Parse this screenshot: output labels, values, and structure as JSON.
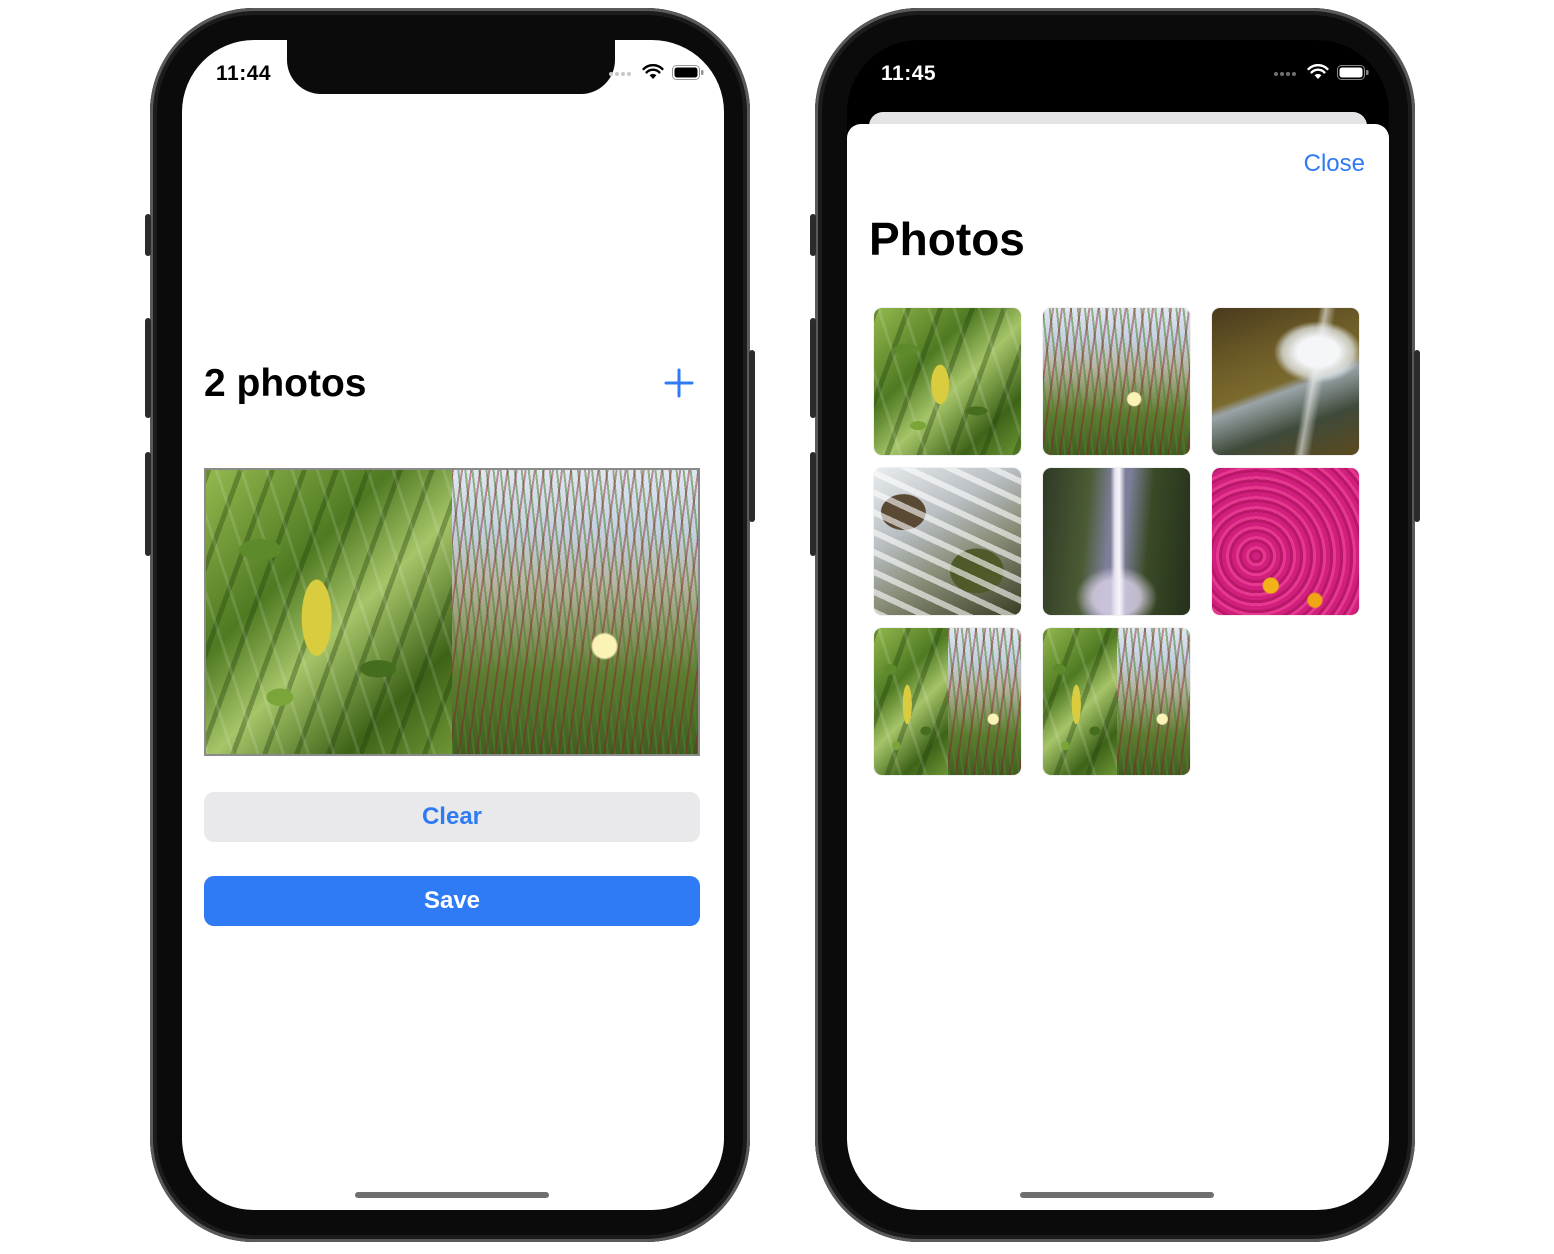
{
  "left_phone": {
    "status": {
      "time": "11:44"
    },
    "header": {
      "title": "2 photos",
      "add_icon": "plus-icon"
    },
    "collage": {
      "photos": [
        "leaf-photo",
        "dune-flower-photo"
      ]
    },
    "buttons": {
      "clear_label": "Clear",
      "save_label": "Save"
    }
  },
  "right_phone": {
    "status": {
      "time": "11:45"
    },
    "sheet": {
      "close_label": "Close",
      "title": "Photos",
      "thumbnails": [
        "leaf-photo",
        "dune-flower-photo",
        "cliff-waterfall-photo",
        "stream-rocks-photo",
        "tall-waterfall-photo",
        "pink-flowers-photo",
        "leaf-dune-collage",
        "leaf-dune-collage"
      ]
    }
  },
  "colors": {
    "accent_blue": "#2f7bf5",
    "clear_button_bg": "#e9e9eb",
    "frame": "#0b0b0b"
  }
}
